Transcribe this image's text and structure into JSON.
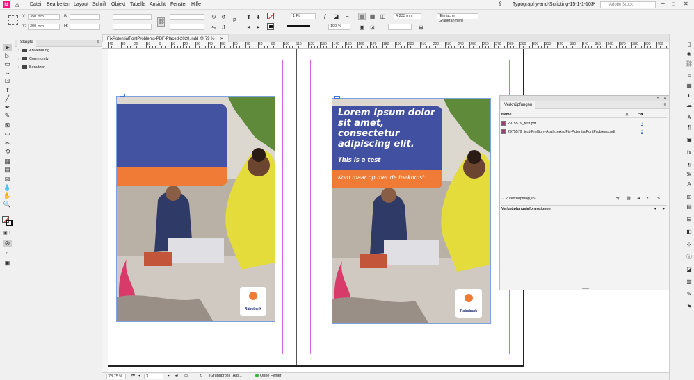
{
  "menubar": {
    "items": [
      "Datei",
      "Bearbeiten",
      "Layout",
      "Schrift",
      "Objekt",
      "Tabelle",
      "Ansicht",
      "Fenster",
      "Hilfe"
    ],
    "doc_title": "Typography-and-Scripting-15-1-1-103",
    "search_placeholder": "Adobe Stock",
    "app_logo": "Id"
  },
  "control": {
    "x_label": "X:",
    "x_value": "350 mm",
    "y_label": "Y:",
    "y_value": "300 mm",
    "w_label": "B:",
    "h_label": "H:",
    "stroke_weight": "1 Pt",
    "opacity": "100 %",
    "size_value": "4,233 mm",
    "frame_style": "[Einfacher Grafikrahmen]"
  },
  "tab": {
    "label": "FixPotentialFontProblems-PDF-Placed-2020.indd @ 79 %"
  },
  "scripts_panel": {
    "title": "Skripte",
    "items": [
      "Anwendung",
      "Community",
      "Benutzer"
    ]
  },
  "ruler": {
    "labels": [
      "40",
      "30",
      "20",
      "10",
      "0",
      "10",
      "20",
      "30",
      "40",
      "50",
      "60",
      "70",
      "80",
      "90",
      "100",
      "110",
      "120",
      "130",
      "140",
      "150",
      "160",
      "170",
      "180",
      "190",
      "200",
      "210",
      "220",
      "230",
      "240",
      "250",
      "260",
      "270",
      "280",
      "290",
      "300",
      "310",
      "320",
      "330",
      "340",
      "350",
      "360",
      "370",
      "380",
      "390",
      "400"
    ]
  },
  "poster": {
    "headline_lines": [
      "Lorem ipsum dolor",
      "sit amet,",
      "consectetur",
      "adipiscing elit."
    ],
    "subline": "This is a test",
    "tagline": "Kom maar op met de toekomst",
    "brand": "Rabobank",
    "colors": {
      "blue": "#3a4a9e",
      "orange": "#ef7b36",
      "yellow": "#e4dc3a"
    }
  },
  "links_panel": {
    "title": "Verknüpfungen",
    "col_name": "Name",
    "rows": [
      {
        "name": "2975579_test.pdf",
        "page": "2"
      },
      {
        "name": "2975579_test-Preflight-AnalyzeAndFix-PotentialFontProblems.pdf",
        "page": "3"
      }
    ],
    "count_text": "2 Verknüpfung(en)",
    "info_title": "Verknüpfungsinformationen"
  },
  "status": {
    "zoom": "78,75 %",
    "page": "3",
    "profile": "[Grundprofil] (Arb...",
    "errors": "Ohne Fehler"
  }
}
